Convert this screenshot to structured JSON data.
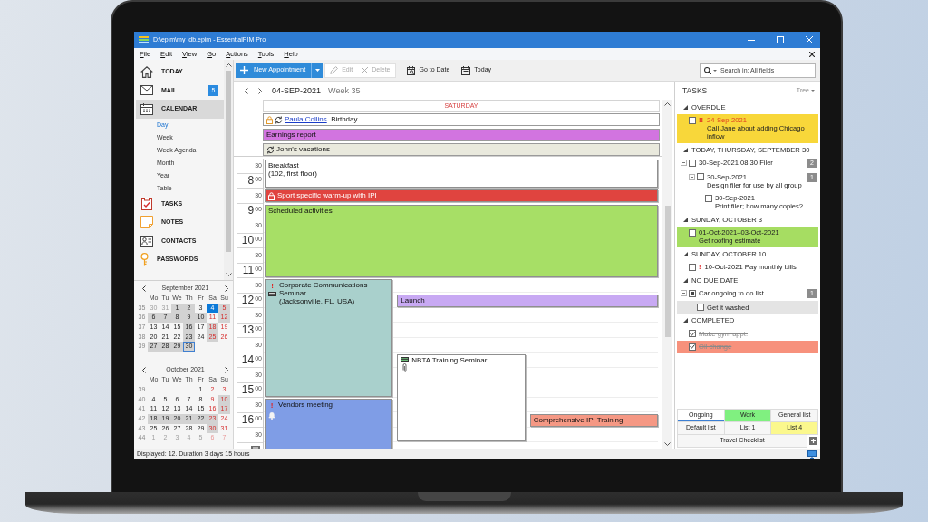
{
  "window": {
    "title": "D:\\epim\\my_db.epim - EssentialPIM Pro"
  },
  "menu": [
    "File",
    "Edit",
    "View",
    "Go",
    "Actions",
    "Tools",
    "Help"
  ],
  "sidebar": {
    "items": [
      {
        "label": "TODAY",
        "selected": false
      },
      {
        "label": "MAIL",
        "selected": false,
        "badge": "5"
      },
      {
        "label": "CALENDAR",
        "selected": true,
        "children": [
          {
            "label": "Day",
            "selected": true
          },
          {
            "label": "Week",
            "selected": false
          },
          {
            "label": "Week Agenda",
            "selected": false
          },
          {
            "label": "Month",
            "selected": false
          },
          {
            "label": "Year",
            "selected": false
          },
          {
            "label": "Table",
            "selected": false
          }
        ]
      },
      {
        "label": "TASKS",
        "selected": false
      },
      {
        "label": "NOTES",
        "selected": false
      },
      {
        "label": "CONTACTS",
        "selected": false
      },
      {
        "label": "PASSWORDS",
        "selected": false
      }
    ]
  },
  "mini_calendars": [
    {
      "title": "September 2021",
      "weekdays": [
        "Mo",
        "Tu",
        "We",
        "Th",
        "Fr",
        "Sa",
        "Su"
      ],
      "weeks": [
        {
          "number": "35",
          "days": [
            {
              "day": "30",
              "other_month": true,
              "busy": false,
              "selected": false,
              "today": false
            },
            {
              "day": "31",
              "other_month": true,
              "busy": false,
              "selected": false,
              "today": false
            },
            {
              "day": "1",
              "other_month": false,
              "busy": true,
              "selected": false,
              "today": false
            },
            {
              "day": "2",
              "other_month": false,
              "busy": true,
              "selected": false,
              "today": false
            },
            {
              "day": "3",
              "other_month": false,
              "busy": false,
              "selected": false,
              "today": false
            },
            {
              "day": "4",
              "other_month": false,
              "busy": false,
              "selected": true,
              "today": false
            },
            {
              "day": "5",
              "other_month": false,
              "busy": true,
              "selected": false,
              "today": false
            }
          ]
        },
        {
          "number": "36",
          "days": [
            {
              "day": "6",
              "other_month": false,
              "busy": true,
              "selected": false,
              "today": false
            },
            {
              "day": "7",
              "other_month": false,
              "busy": true,
              "selected": false,
              "today": false
            },
            {
              "day": "8",
              "other_month": false,
              "busy": true,
              "selected": false,
              "today": false
            },
            {
              "day": "9",
              "other_month": false,
              "busy": true,
              "selected": false,
              "today": false
            },
            {
              "day": "10",
              "other_month": false,
              "busy": true,
              "selected": false,
              "today": false
            },
            {
              "day": "11",
              "other_month": false,
              "busy": false,
              "selected": false,
              "today": false
            },
            {
              "day": "12",
              "other_month": false,
              "busy": true,
              "selected": false,
              "today": false
            }
          ]
        },
        {
          "number": "37",
          "days": [
            {
              "day": "13",
              "other_month": false,
              "busy": false,
              "selected": false,
              "today": false
            },
            {
              "day": "14",
              "other_month": false,
              "busy": false,
              "selected": false,
              "today": false
            },
            {
              "day": "15",
              "other_month": false,
              "busy": false,
              "selected": false,
              "today": false
            },
            {
              "day": "16",
              "other_month": false,
              "busy": true,
              "selected": false,
              "today": false
            },
            {
              "day": "17",
              "other_month": false,
              "busy": false,
              "selected": false,
              "today": false
            },
            {
              "day": "18",
              "other_month": false,
              "busy": true,
              "selected": false,
              "today": false
            },
            {
              "day": "19",
              "other_month": false,
              "busy": false,
              "selected": false,
              "today": false
            }
          ]
        },
        {
          "number": "38",
          "days": [
            {
              "day": "20",
              "other_month": false,
              "busy": false,
              "selected": false,
              "today": false
            },
            {
              "day": "21",
              "other_month": false,
              "busy": false,
              "selected": false,
              "today": false
            },
            {
              "day": "22",
              "other_month": false,
              "busy": false,
              "selected": false,
              "today": false
            },
            {
              "day": "23",
              "other_month": false,
              "busy": true,
              "selected": false,
              "today": false
            },
            {
              "day": "24",
              "other_month": false,
              "busy": false,
              "selected": false,
              "today": false
            },
            {
              "day": "25",
              "other_month": false,
              "busy": true,
              "selected": false,
              "today": false
            },
            {
              "day": "26",
              "other_month": false,
              "busy": false,
              "selected": false,
              "today": false
            }
          ]
        },
        {
          "number": "39",
          "days": [
            {
              "day": "27",
              "other_month": false,
              "busy": true,
              "selected": false,
              "today": false
            },
            {
              "day": "28",
              "other_month": false,
              "busy": true,
              "selected": false,
              "today": false
            },
            {
              "day": "29",
              "other_month": false,
              "busy": true,
              "selected": false,
              "today": false
            },
            {
              "day": "30",
              "other_month": false,
              "busy": true,
              "selected": false,
              "today": true
            }
          ]
        }
      ]
    },
    {
      "title": "October 2021",
      "weekdays": [
        "Mo",
        "Tu",
        "We",
        "Th",
        "Fr",
        "Sa",
        "Su"
      ],
      "weeks": [
        {
          "number": "39",
          "days": [
            {
              "day": "1",
              "other_month": false,
              "busy": false,
              "selected": false,
              "today": false
            },
            {
              "day": "2",
              "other_month": false,
              "busy": false,
              "selected": false,
              "today": false
            },
            {
              "day": "3",
              "other_month": false,
              "busy": false,
              "selected": false,
              "today": false
            }
          ]
        },
        {
          "number": "40",
          "days": [
            {
              "day": "4",
              "other_month": false,
              "busy": false,
              "selected": false,
              "today": false
            },
            {
              "day": "5",
              "other_month": false,
              "busy": false,
              "selected": false,
              "today": false
            },
            {
              "day": "6",
              "other_month": false,
              "busy": false,
              "selected": false,
              "today": false
            },
            {
              "day": "7",
              "other_month": false,
              "busy": false,
              "selected": false,
              "today": false
            },
            {
              "day": "8",
              "other_month": false,
              "busy": false,
              "selected": false,
              "today": false
            },
            {
              "day": "9",
              "other_month": false,
              "busy": false,
              "selected": false,
              "today": false
            },
            {
              "day": "10",
              "other_month": false,
              "busy": true,
              "selected": false,
              "today": false
            }
          ]
        },
        {
          "number": "41",
          "days": [
            {
              "day": "11",
              "other_month": false,
              "busy": false,
              "selected": false,
              "today": false
            },
            {
              "day": "12",
              "other_month": false,
              "busy": false,
              "selected": false,
              "today": false
            },
            {
              "day": "13",
              "other_month": false,
              "busy": false,
              "selected": false,
              "today": false
            },
            {
              "day": "14",
              "other_month": false,
              "busy": false,
              "selected": false,
              "today": false
            },
            {
              "day": "15",
              "other_month": false,
              "busy": false,
              "selected": false,
              "today": false
            },
            {
              "day": "16",
              "other_month": false,
              "busy": false,
              "selected": false,
              "today": false
            },
            {
              "day": "17",
              "other_month": false,
              "busy": true,
              "selected": false,
              "today": false
            }
          ]
        },
        {
          "number": "42",
          "days": [
            {
              "day": "18",
              "other_month": false,
              "busy": true,
              "selected": false,
              "today": false
            },
            {
              "day": "19",
              "other_month": false,
              "busy": true,
              "selected": false,
              "today": false
            },
            {
              "day": "20",
              "other_month": false,
              "busy": true,
              "selected": false,
              "today": false
            },
            {
              "day": "21",
              "other_month": false,
              "busy": true,
              "selected": false,
              "today": false
            },
            {
              "day": "22",
              "other_month": false,
              "busy": true,
              "selected": false,
              "today": false
            },
            {
              "day": "23",
              "other_month": false,
              "busy": true,
              "selected": false,
              "today": false
            },
            {
              "day": "24",
              "other_month": false,
              "busy": false,
              "selected": false,
              "today": false
            }
          ]
        },
        {
          "number": "43",
          "days": [
            {
              "day": "25",
              "other_month": false,
              "busy": false,
              "selected": false,
              "today": false
            },
            {
              "day": "26",
              "other_month": false,
              "busy": false,
              "selected": false,
              "today": false
            },
            {
              "day": "27",
              "other_month": false,
              "busy": false,
              "selected": false,
              "today": false
            },
            {
              "day": "28",
              "other_month": false,
              "busy": false,
              "selected": false,
              "today": false
            },
            {
              "day": "29",
              "other_month": false,
              "busy": false,
              "selected": false,
              "today": false
            },
            {
              "day": "30",
              "other_month": false,
              "busy": true,
              "selected": false,
              "today": false
            },
            {
              "day": "31",
              "other_month": false,
              "busy": false,
              "selected": false,
              "today": false
            }
          ]
        },
        {
          "number": "44",
          "days": [
            {
              "day": "1",
              "other_month": true,
              "busy": false,
              "selected": false,
              "today": false
            },
            {
              "day": "2",
              "other_month": true,
              "busy": false,
              "selected": false,
              "today": false
            },
            {
              "day": "3",
              "other_month": true,
              "busy": false,
              "selected": false,
              "today": false
            },
            {
              "day": "4",
              "other_month": true,
              "busy": false,
              "selected": false,
              "today": false
            },
            {
              "day": "5",
              "other_month": true,
              "busy": false,
              "selected": false,
              "today": false
            },
            {
              "day": "6",
              "other_month": true,
              "busy": false,
              "selected": false,
              "today": false
            },
            {
              "day": "7",
              "other_month": true,
              "busy": false,
              "selected": false,
              "today": false
            }
          ]
        }
      ]
    }
  ],
  "toolbar": {
    "buttons": [
      {
        "label": "New Appointment",
        "kind": "primary",
        "disabled": false
      },
      {
        "label": "Edit",
        "kind": "grouped",
        "disabled": true
      },
      {
        "label": "Delete",
        "kind": "grouped",
        "disabled": true
      },
      {
        "label": "Go to Date",
        "kind": "plain",
        "disabled": false
      },
      {
        "label": "Today",
        "kind": "plain",
        "disabled": false
      }
    ],
    "search": {
      "placeholder": "Search in: All fields"
    }
  },
  "calendar": {
    "date": "04-SEP-2021",
    "week": "Week 35",
    "day_name": "SATURDAY",
    "all_day": [
      {
        "link": "Paula Collins",
        "title": ". Birthday",
        "color": "#ffffff",
        "locked": true,
        "recurring": true
      },
      {
        "title": "Earnings report",
        "color": "#d274e0",
        "locked": false,
        "recurring": false
      },
      {
        "title": "John's vacations",
        "color": "#e9e9dd",
        "locked": false,
        "recurring": true
      }
    ],
    "time_slots": [
      {
        "minutes": "30"
      },
      {
        "hour": "8",
        "minutes": "00"
      },
      {
        "minutes": "30"
      },
      {
        "hour": "9",
        "minutes": "00"
      },
      {
        "minutes": "30"
      },
      {
        "hour": "10",
        "minutes": "00"
      },
      {
        "minutes": "30"
      },
      {
        "hour": "11",
        "minutes": "00"
      },
      {
        "minutes": "30"
      },
      {
        "hour": "12",
        "minutes": "00"
      },
      {
        "minutes": "30"
      },
      {
        "hour": "13",
        "minutes": "00"
      },
      {
        "minutes": "30"
      },
      {
        "hour": "14",
        "minutes": "00"
      },
      {
        "minutes": "30"
      },
      {
        "hour": "15",
        "minutes": "00"
      },
      {
        "minutes": "30"
      },
      {
        "hour": "16",
        "minutes": "00"
      },
      {
        "minutes": "30"
      }
    ],
    "events": [
      {
        "title": "Breakfast",
        "location": "(102, first floor)",
        "color": "#ffffff",
        "locked": false,
        "reminder": false,
        "linked": false,
        "attachment": false
      },
      {
        "title": "Sport specific warm-up with IPI",
        "color": "#e0443f",
        "locked": true,
        "reminder": false,
        "linked": false,
        "attachment": false
      },
      {
        "title": "Scheduled activities",
        "color": "#a7df66",
        "locked": false,
        "reminder": false,
        "linked": false,
        "attachment": false
      },
      {
        "title": "Corporate Communications Seminar",
        "location": "(Jacksonville, FL, USA)",
        "priority": "!",
        "color": "#a9d0cc",
        "locked": false,
        "reminder": false,
        "linked": true,
        "attachment": false
      },
      {
        "title": "Launch",
        "color": "#c8a9f3",
        "locked": false,
        "reminder": false,
        "linked": false,
        "attachment": false
      },
      {
        "title": "NBTA Training Seminar",
        "color": "#ffffff",
        "locked": false,
        "reminder": false,
        "linked": true,
        "attachment": true
      },
      {
        "title": "Vendors meeting",
        "priority": "!",
        "color": "#7f9de6",
        "locked": false,
        "reminder": true,
        "linked": false,
        "attachment": false
      },
      {
        "title": "Comprehensive IPI Training",
        "color": "#f59884",
        "locked": false,
        "reminder": false,
        "linked": false,
        "attachment": false
      }
    ]
  },
  "tasks": {
    "title": "TASKS",
    "view": "Tree",
    "groups": [
      {
        "label": "OVERDUE",
        "expanded": true,
        "items": [
          {
            "date": "24-Sep-2021",
            "text": "Call Jane about adding Chicago inflow",
            "priority": "!!",
            "overdue": true,
            "checked": false,
            "selected": false,
            "color": "#f8d73a"
          }
        ]
      },
      {
        "label": "TODAY, THURSDAY, SEPTEMBER 30",
        "expanded": true,
        "items": [
          {
            "text": "30-Sep-2021 08:30 Filer",
            "overdue": false,
            "checked": false,
            "selected": false,
            "count": "2",
            "expanded": true,
            "children": [
              {
                "date": "30-Sep-2021",
                "text": "Design filer for use by all group",
                "overdue": false,
                "checked": false,
                "selected": false,
                "count": "1",
                "expanded": true,
                "children": [
                  {
                    "date": "30-Sep-2021",
                    "text": "Print filer; how many copies?",
                    "overdue": false,
                    "checked": false,
                    "selected": false
                  }
                ]
              }
            ]
          }
        ]
      },
      {
        "label": "SUNDAY, OCTOBER 3",
        "expanded": true,
        "items": [
          {
            "date": "01-Oct-2021–03-Oct-2021",
            "text": "Get roofing estimate",
            "overdue": false,
            "checked": false,
            "selected": false,
            "color": "#a6dd62"
          }
        ]
      },
      {
        "label": "SUNDAY, OCTOBER 10",
        "expanded": true,
        "items": [
          {
            "text": "10-Oct-2021 Pay monthly bills",
            "priority": "!",
            "overdue": false,
            "checked": false,
            "selected": false
          }
        ]
      },
      {
        "label": "NO DUE DATE",
        "expanded": true,
        "items": [
          {
            "text": "Car ongoing to do list",
            "overdue": false,
            "partial": true,
            "selected": false,
            "count": "1",
            "expanded": true,
            "children": [
              {
                "text": "Get it washed",
                "overdue": false,
                "checked": false,
                "selected": true
              }
            ]
          }
        ]
      },
      {
        "label": "COMPLETED",
        "expanded": true,
        "items": [
          {
            "text": "Make gym appt.",
            "overdue": false,
            "checked": true,
            "selected": false
          },
          {
            "text": "Oil change",
            "overdue": false,
            "checked": true,
            "selected": false,
            "color": "#f7917c"
          }
        ]
      }
    ]
  },
  "list_tabs": {
    "rows": [
      {
        "tabs": [
          {
            "label": "Ongoing",
            "selected": true
          },
          {
            "label": "Work",
            "selected": false,
            "color": "#80f080"
          },
          {
            "label": "General list",
            "selected": false
          }
        ]
      },
      {
        "tabs": [
          {
            "label": "Default list",
            "selected": false
          },
          {
            "label": "List 1",
            "selected": false
          },
          {
            "label": "List 4",
            "selected": false,
            "color": "#fbf88d"
          }
        ]
      },
      {
        "tabs": [
          {
            "label": "Travel Checklist",
            "selected": false
          }
        ]
      }
    ]
  },
  "status_bar": {
    "text": "Displayed: 12. Duration 3 days 15 hours"
  }
}
